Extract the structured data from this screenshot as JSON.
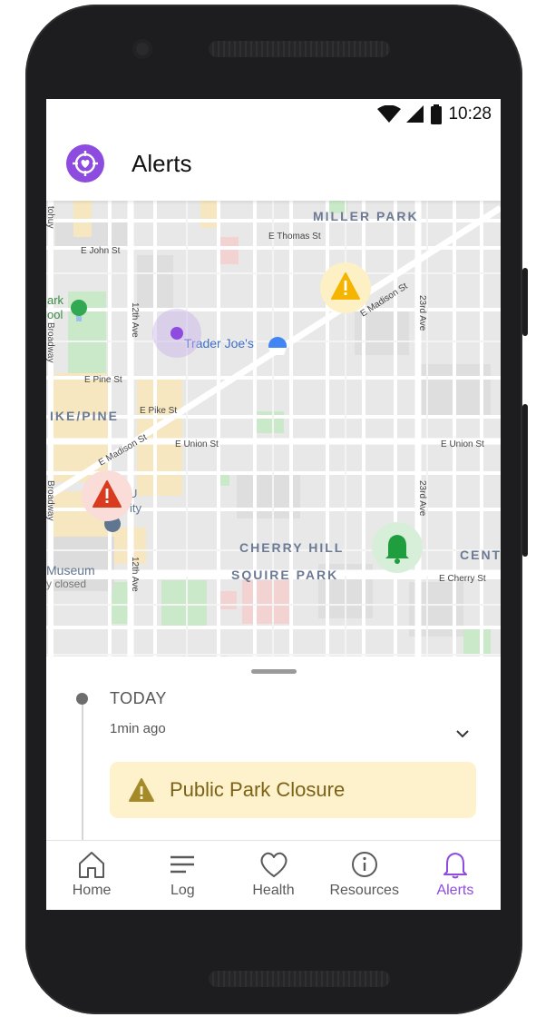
{
  "status_bar": {
    "time": "10:28"
  },
  "app_bar": {
    "title": "Alerts"
  },
  "map": {
    "labels": {
      "miller_park": "MILLER PARK",
      "e_thomas": "E Thomas St",
      "e_john": "E John St",
      "ark": "ark",
      "ool": "ool",
      "broadway_top": "Broadway",
      "broadway_bottom": "Broadway",
      "twelfth_top": "12th Ave",
      "twelfth_bottom": "12th Ave",
      "trader_joes": "Trader Joe's",
      "e_madison_right": "E Madison St",
      "e_madison_left": "E Madison St",
      "twentythird_top": "23rd Ave",
      "twentythird_bottom": "23rd Ave",
      "e_pine": "E Pine St",
      "e_pike": "E Pike St",
      "pike_pine": "IKE/PINE",
      "e_union_mid": "E Union St",
      "e_union_right": "E Union St",
      "university_1": "U",
      "university_2": "ity",
      "bdwy_left": "Broadway",
      "cherry_hill": "CHERRY HILL",
      "squire_park": "SQUIRE PARK",
      "cent": "CENT",
      "e_cherry": "E Cherry St",
      "museum": "Museum",
      "closed": "y closed",
      "tohuy": "tohuy"
    },
    "markers": [
      {
        "name": "warning-marker-yellow",
        "color": "#f4b400",
        "bg": "#fdf0c4"
      },
      {
        "name": "warning-marker-red",
        "color": "#d93b1e",
        "bg": "#fadcd8"
      },
      {
        "name": "bell-marker-green",
        "color": "#1e9e3e",
        "bg": "#d7efd9"
      },
      {
        "name": "location-dot",
        "color": "#8e4be0"
      }
    ]
  },
  "timeline": {
    "section": "TODAY",
    "time_ago": "1min ago",
    "alert": {
      "title": "Public Park Closure",
      "accent": "#7c6218",
      "background": "#fdf2cb"
    }
  },
  "nav": {
    "items": [
      {
        "label": "Home",
        "icon": "home-icon"
      },
      {
        "label": "Log",
        "icon": "log-icon"
      },
      {
        "label": "Health",
        "icon": "heart-icon"
      },
      {
        "label": "Resources",
        "icon": "info-icon"
      },
      {
        "label": "Alerts",
        "icon": "bell-icon",
        "active": true
      }
    ],
    "active_color": "#8e4be0"
  }
}
